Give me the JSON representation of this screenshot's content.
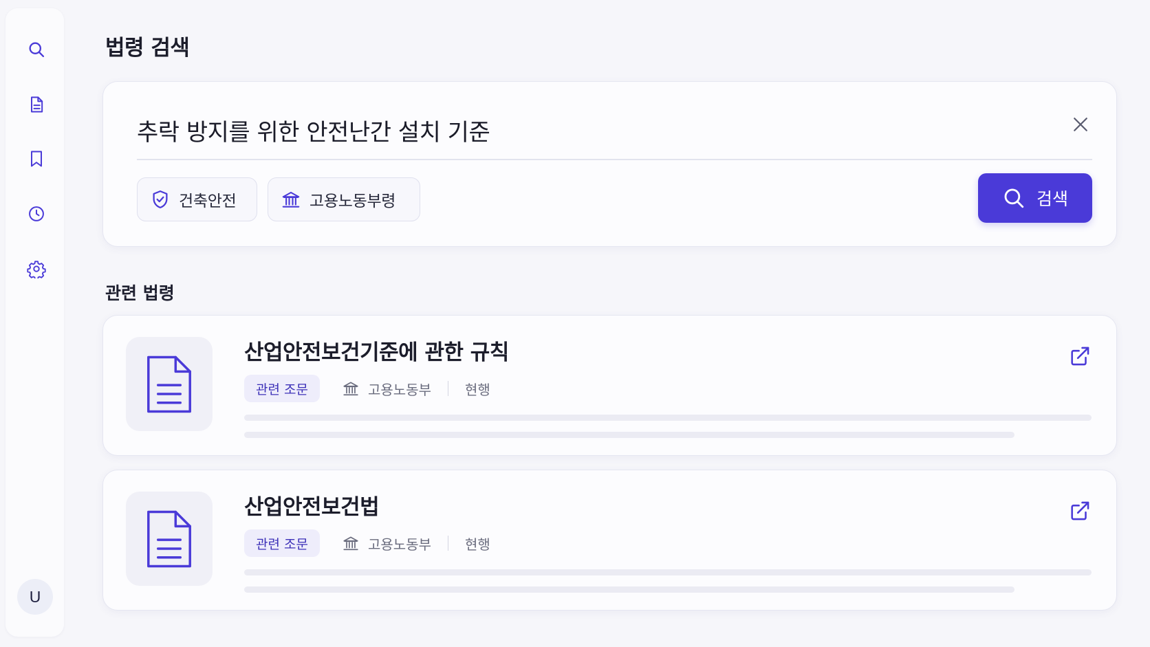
{
  "sidebar": {
    "items": [
      {
        "icon": "search-icon"
      },
      {
        "icon": "document-icon"
      },
      {
        "icon": "bookmark-icon"
      },
      {
        "icon": "history-icon"
      },
      {
        "icon": "settings-icon"
      }
    ],
    "avatar_initial": "U"
  },
  "page": {
    "title": "법령 검색"
  },
  "search": {
    "query": "추락 방지를 위한 안전난간 설치 기준",
    "filters": [
      {
        "label": "건축안전",
        "icon": "shield-check-icon"
      },
      {
        "label": "고용노동부령",
        "icon": "institution-icon"
      }
    ],
    "button_label": "검색"
  },
  "results": {
    "section_title": "관련 법령",
    "items": [
      {
        "title": "산업안전보건기준에 관한 규칙",
        "tag": "관련 조문",
        "agency": "고용노동부",
        "status": "현행"
      },
      {
        "title": "산업안전보건법",
        "tag": "관련 조문",
        "agency": "고용노동부",
        "status": "현행"
      }
    ]
  },
  "colors": {
    "accent": "#4a3ad8",
    "background": "#f6f6fa",
    "card": "#fcfcfe",
    "tag_bg": "#eeedfb",
    "icon": "#4a3ad8"
  }
}
